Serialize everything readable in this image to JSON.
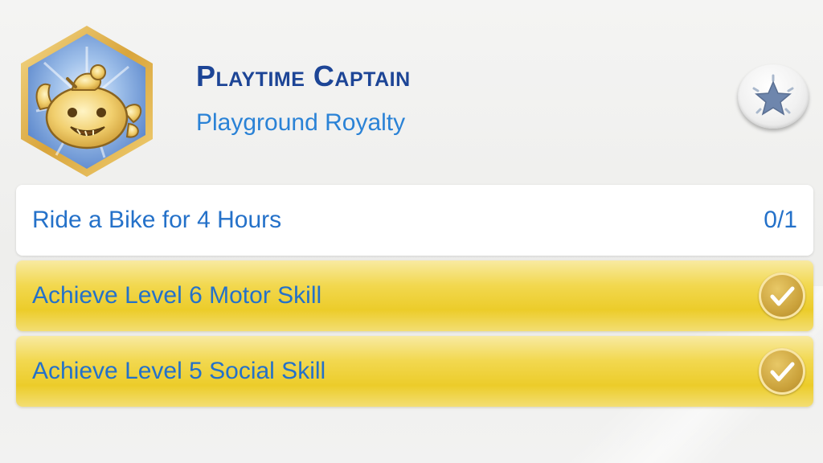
{
  "aspiration": {
    "title": "Playtime Captain",
    "subtitle": "Playground Royalty",
    "badge_icon": "playground-aspiration-badge-icon",
    "favorite_icon": "star-icon"
  },
  "goals": [
    {
      "label": "Ride a Bike for 4 Hours",
      "progress": "0/1",
      "completed": false
    },
    {
      "label": "Achieve Level 6 Motor Skill",
      "completed": true,
      "icon": "checkmark-icon"
    },
    {
      "label": "Achieve Level 5 Social Skill",
      "completed": true,
      "icon": "checkmark-icon"
    }
  ],
  "colors": {
    "title": "#1d4596",
    "subtitle": "#2a82d6",
    "goal_text": "#2471c9",
    "complete_bg": "#eccc2a",
    "badge_frame": "#e6b94a",
    "badge_fill": "#7fa6de"
  }
}
